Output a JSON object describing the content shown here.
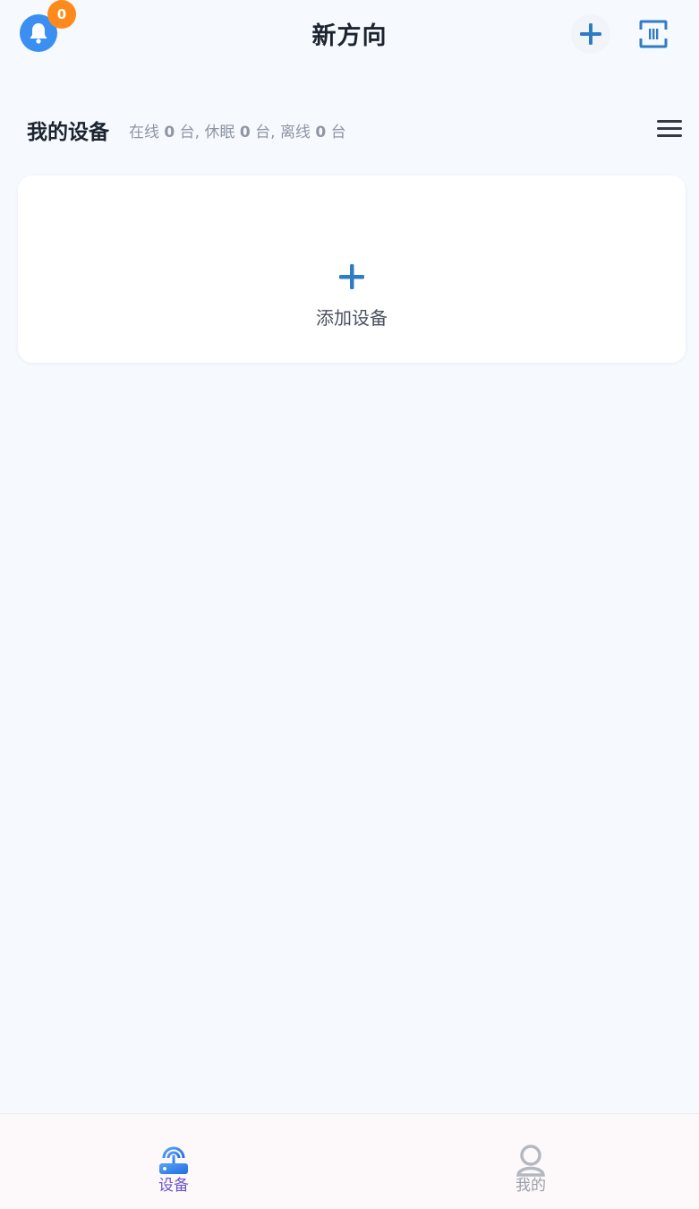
{
  "header": {
    "title": "新方向",
    "notification_count": "0",
    "icons": [
      "bell-icon",
      "plus-icon",
      "scan-icon"
    ],
    "accent_color": "#3a8ff0",
    "badge_color": "#ff8a1c"
  },
  "section": {
    "title": "我的设备",
    "status": {
      "online_label": "在线",
      "online_count": "0",
      "sleep_label": "休眠",
      "sleep_count": "0",
      "offline_label": "离线",
      "offline_count": "0",
      "unit": "台"
    }
  },
  "card": {
    "add_label": "添加设备"
  },
  "bottom_nav": {
    "items": [
      {
        "label": "设备",
        "icon": "router-icon",
        "active": true
      },
      {
        "label": "我的",
        "icon": "user-icon",
        "active": false
      }
    ]
  }
}
